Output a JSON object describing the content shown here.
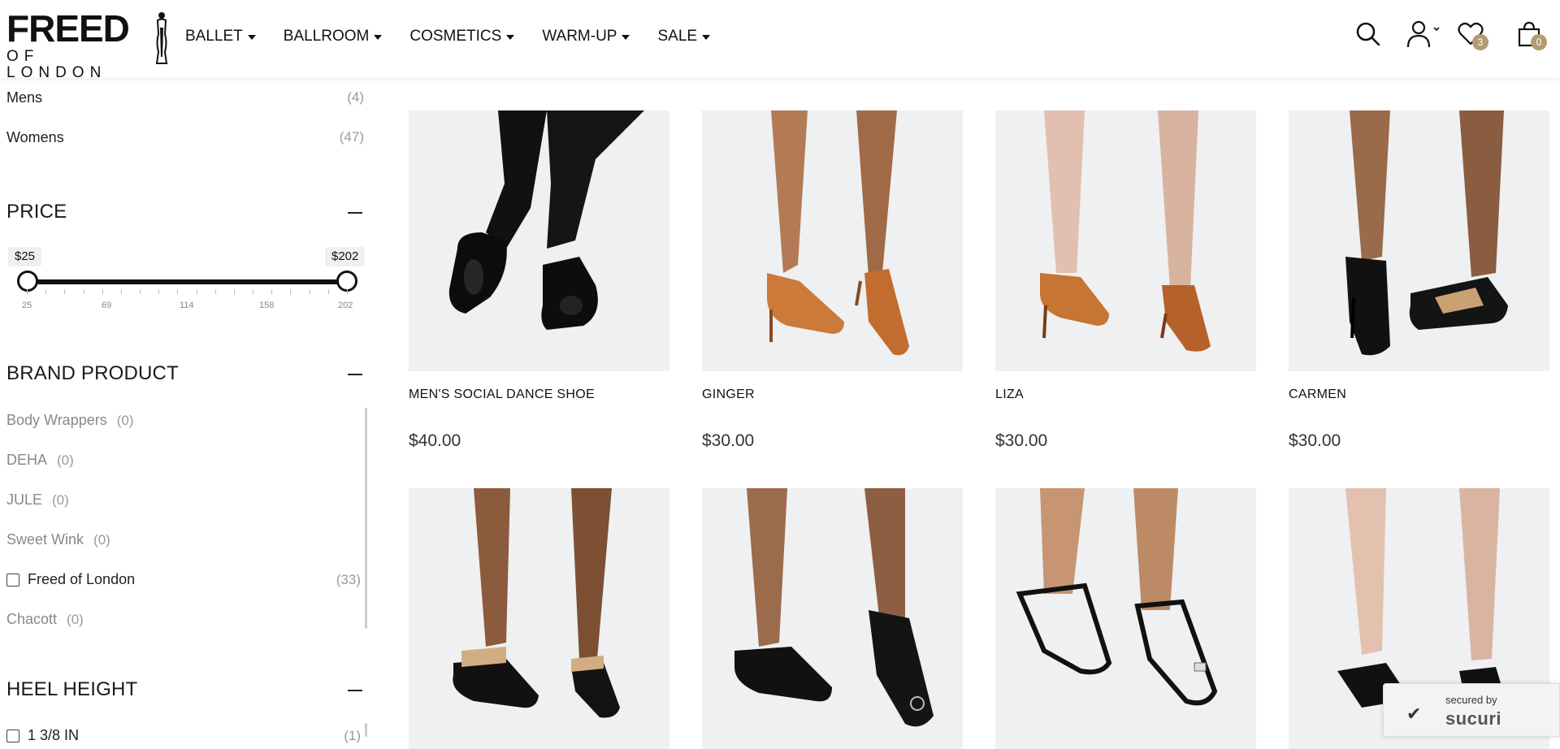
{
  "header": {
    "logo_main": "FREED",
    "logo_sub": "OF LONDON",
    "nav": [
      {
        "label": "BALLET"
      },
      {
        "label": "BALLROOM"
      },
      {
        "label": "COSMETICS"
      },
      {
        "label": "WARM-UP"
      },
      {
        "label": "SALE"
      }
    ],
    "icons": [
      "search-icon",
      "account-icon",
      "wishlist-icon",
      "cart-icon"
    ],
    "wishlist_count": "3",
    "cart_count": "0",
    "badge_color": "#b39c72"
  },
  "sidebar": {
    "gender": [
      {
        "label": "Mens",
        "count": "(4)"
      },
      {
        "label": "Womens",
        "count": "(47)"
      }
    ],
    "price": {
      "title": "PRICE",
      "min_label": "$25",
      "max_label": "$202",
      "min": 25,
      "max": 202,
      "ticks": [
        "25",
        "69",
        "114",
        "158",
        "202"
      ]
    },
    "brand": {
      "title": "BRAND PRODUCT",
      "items": [
        {
          "label": "Body Wrappers",
          "count": "(0)"
        },
        {
          "label": "DEHA",
          "count": "(0)"
        },
        {
          "label": "JULE",
          "count": "(0)"
        },
        {
          "label": "Sweet Wink",
          "count": "(0)"
        },
        {
          "label": "Freed of London",
          "count": "(33)"
        },
        {
          "label": "Chacott",
          "count": "(0)"
        }
      ]
    },
    "heel": {
      "title": "HEEL HEIGHT",
      "items": [
        {
          "label": "1 3/8 IN",
          "count": "(1)"
        }
      ]
    }
  },
  "products": [
    {
      "name": "MEN'S SOCIAL DANCE SHOE",
      "price": "$40.00"
    },
    {
      "name": "GINGER",
      "price": "$30.00"
    },
    {
      "name": "LIZA",
      "price": "$30.00"
    },
    {
      "name": "CARMEN",
      "price": "$30.00"
    },
    {
      "name": "",
      "price": ""
    },
    {
      "name": "",
      "price": ""
    },
    {
      "name": "",
      "price": ""
    },
    {
      "name": "",
      "price": ""
    }
  ],
  "sucuri": {
    "small": "secured by",
    "brand": "sucuri"
  }
}
